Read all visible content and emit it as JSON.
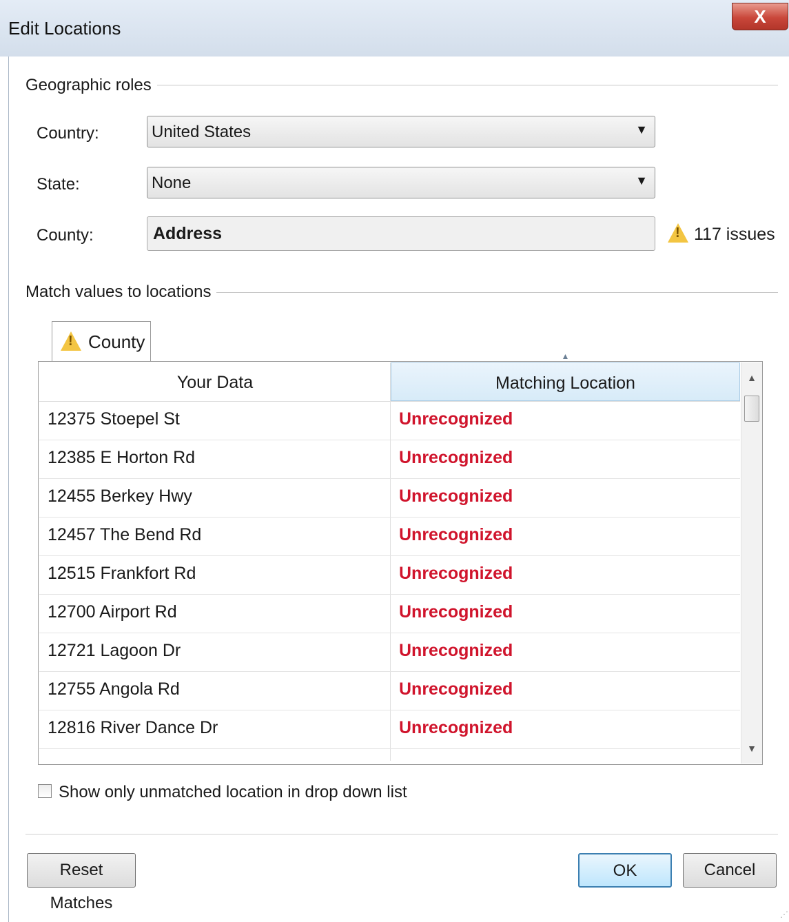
{
  "window": {
    "title": "Edit Locations",
    "close_glyph": "X"
  },
  "geo": {
    "section_label": "Geographic roles",
    "country_label": "Country:",
    "country_value": "United States",
    "state_label": "State:",
    "state_value": "None",
    "county_label": "County:",
    "county_value": "Address",
    "issues_text": "117 issues"
  },
  "match": {
    "section_label": "Match values to locations",
    "tab_label": "County",
    "col_your_data": "Your Data",
    "col_matching": "Matching Location",
    "rows": [
      {
        "data": "12375 Stoepel St",
        "match": "Unrecognized"
      },
      {
        "data": "12385 E Horton Rd",
        "match": "Unrecognized"
      },
      {
        "data": "12455 Berkey Hwy",
        "match": "Unrecognized"
      },
      {
        "data": "12457 The Bend Rd",
        "match": "Unrecognized"
      },
      {
        "data": "12515 Frankfort Rd",
        "match": "Unrecognized"
      },
      {
        "data": "12700 Airport Rd",
        "match": "Unrecognized"
      },
      {
        "data": "12721 Lagoon Dr",
        "match": "Unrecognized"
      },
      {
        "data": "12755 Angola Rd",
        "match": "Unrecognized"
      },
      {
        "data": "12816 River Dance Dr",
        "match": "Unrecognized"
      }
    ],
    "unrecognized_color": "#d0142c"
  },
  "options": {
    "show_unmatched_label": "Show only unmatched location in drop down list",
    "show_unmatched_checked": false
  },
  "buttons": {
    "reset": "Reset Matches",
    "ok": "OK",
    "cancel": "Cancel"
  },
  "icons": {
    "warning": "warning-icon",
    "dropdown": "chevron-down-icon",
    "sort": "sort-ascending-icon"
  }
}
